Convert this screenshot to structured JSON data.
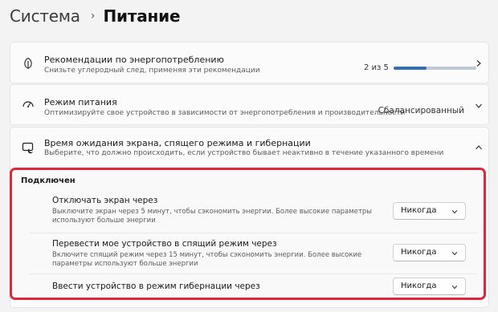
{
  "breadcrumb": {
    "parent": "Система",
    "separator": "›",
    "current": "Питание"
  },
  "recommendations": {
    "title": "Рекомендации по энергопотреблению",
    "subtitle": "Снизьте углеродный след, применяя эти рекомендации",
    "progress_text": "2 из 5",
    "progress_fraction": 0.4,
    "icon": "leaf-icon"
  },
  "power_mode": {
    "title": "Режим питания",
    "subtitle": "Оптимизируйте свое устройство в зависимости от энергопотребления и производительности",
    "value": "Сбалансированный",
    "icon": "speedometer-icon"
  },
  "sleep": {
    "title": "Время ожидания экрана, спящего режима и гибернации",
    "subtitle": "Выберите, что должно происходить, если устройство бывает неактивно в течение указанного времени",
    "icon": "screen-sleep-icon",
    "section_label": "Подключен",
    "rows": [
      {
        "title": "Отключать экран через",
        "description": "Выключите экран через 5 минут, чтобы сэкономить энергии. Более высокие параметры используют больше энергии",
        "value": "Никогда"
      },
      {
        "title": "Перевести мое устройство в спящий режим через",
        "description": "Включите спящий режим через 15 минут, чтобы сэкономить энергии. Более высокие параметры используют больше энергии",
        "value": "Никогда"
      },
      {
        "title": "Ввести устройство в режим гибернации через",
        "description": "",
        "value": "Никогда"
      }
    ]
  },
  "colors": {
    "accent": "#2e6fb7",
    "highlight_border": "#e0263a",
    "background": "#f3f3f3"
  }
}
